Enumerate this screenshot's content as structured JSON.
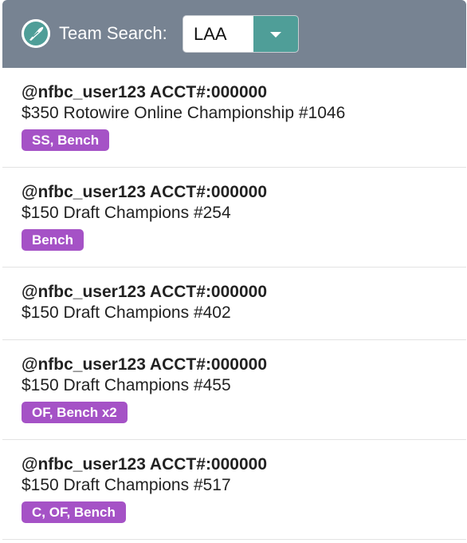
{
  "header": {
    "logo_icon": "quill-logo-icon",
    "label": "Team Search:",
    "selected_team": "LAA",
    "dropdown_icon": "chevron-down-icon",
    "background": "#778392",
    "accent": "#4f9e98"
  },
  "entries": [
    {
      "user": "@nfbc_user123 ACCT#:000000",
      "league": "$350 Rotowire Online Championship #1046",
      "positions": "SS, Bench"
    },
    {
      "user": "@nfbc_user123 ACCT#:000000",
      "league": "$150 Draft Champions #254",
      "positions": "Bench"
    },
    {
      "user": "@nfbc_user123 ACCT#:000000",
      "league": "$150 Draft Champions #402",
      "positions": ""
    },
    {
      "user": "@nfbc_user123 ACCT#:000000",
      "league": "$150 Draft Champions #455",
      "positions": "OF, Bench x2"
    },
    {
      "user": "@nfbc_user123 ACCT#:000000",
      "league": "$150 Draft Champions #517",
      "positions": "C, OF, Bench"
    }
  ],
  "tag_color": "#a552c6"
}
